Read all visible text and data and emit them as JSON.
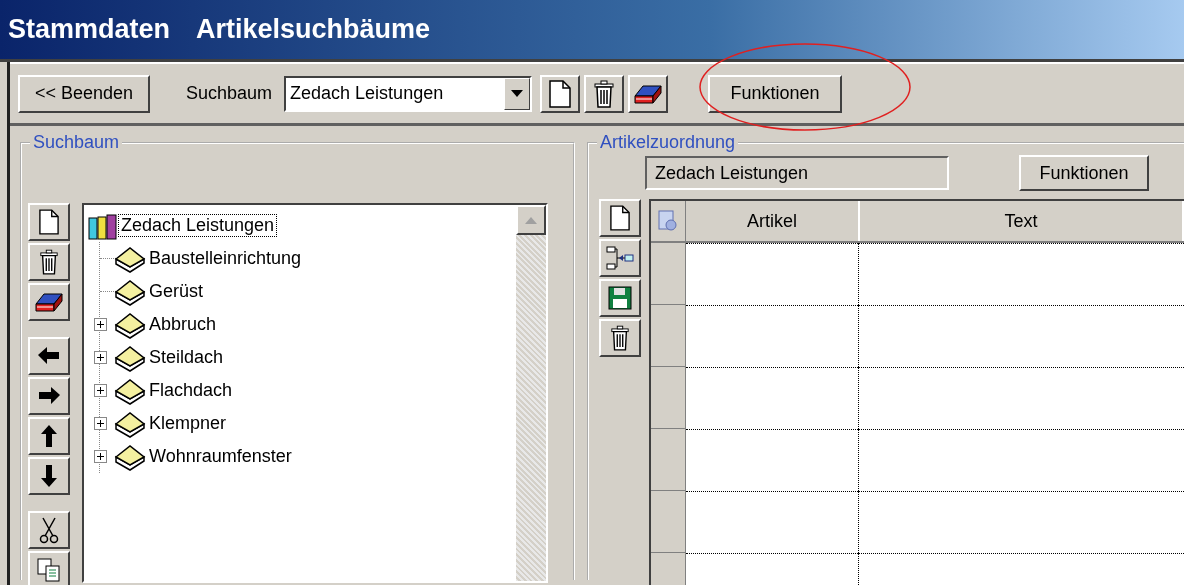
{
  "window": {
    "title": "Stammdaten",
    "subtitle": "Artikelsuchbäume"
  },
  "toolbar": {
    "exit_button": "<< Beenden",
    "tree_label": "Suchbaum",
    "tree_select": {
      "value": "Zedach Leistungen"
    },
    "functions_button": "Funktionen"
  },
  "search_tree": {
    "legend": "Suchbaum",
    "root": {
      "label": "Zedach Leistungen",
      "selected": true,
      "expanded": true,
      "children": [
        {
          "label": "Baustelleinrichtung",
          "selected": false,
          "has_children": false
        },
        {
          "label": "Gerüst",
          "selected": false,
          "has_children": false
        },
        {
          "label": "Abbruch",
          "selected": false,
          "has_children": true
        },
        {
          "label": "Steildach",
          "selected": false,
          "has_children": true
        },
        {
          "label": "Flachdach",
          "selected": false,
          "has_children": true
        },
        {
          "label": "Klempner",
          "selected": false,
          "has_children": true
        },
        {
          "label": "Wohnraumfenster",
          "selected": false,
          "has_children": true
        }
      ]
    }
  },
  "assignment": {
    "legend": "Artikelzuordnung",
    "tree_field": {
      "value": "Zedach Leistungen"
    },
    "functions_button": "Funktionen",
    "table": {
      "columns": [
        "Artikel",
        "Text"
      ]
    }
  }
}
